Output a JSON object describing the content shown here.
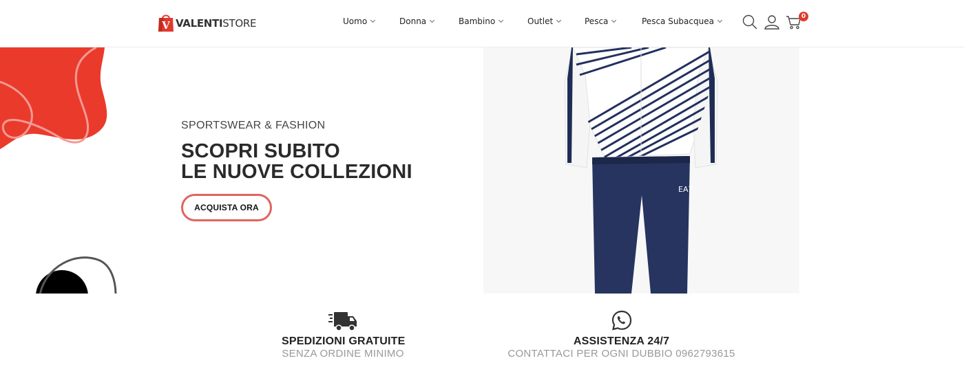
{
  "brand": {
    "logo_bold": "VALENTI",
    "logo_light": "STORE",
    "logo_mark": "V",
    "accent_color": "#e03a2f"
  },
  "nav": {
    "items": [
      {
        "label": "Uomo"
      },
      {
        "label": "Donna"
      },
      {
        "label": "Bambino"
      },
      {
        "label": "Outlet"
      },
      {
        "label": "Pesca"
      },
      {
        "label": "Pesca Subacquea"
      }
    ],
    "icons": [
      "search-icon",
      "user-icon",
      "cart-icon"
    ],
    "cart_count": "0"
  },
  "hero": {
    "subtitle": "SPORTSWEAR & FASHION",
    "title_line1": "SCOPRI SUBITO",
    "title_line2": "LE NUOVE COLLEZIONI",
    "cta_label": "ACQUISTA ORA",
    "cta_border_color": "#e06460"
  },
  "features": [
    {
      "icon": "delivery-truck-icon",
      "title": "SPEDIZIONI GRATUITE",
      "subtitle": "SENZA ORDINE MINIMO"
    },
    {
      "icon": "whatsapp-icon",
      "title": "ASSISTENZA 24/7",
      "subtitle": "CONTATTACI PER OGNI DUBBIO 0962793615"
    }
  ]
}
